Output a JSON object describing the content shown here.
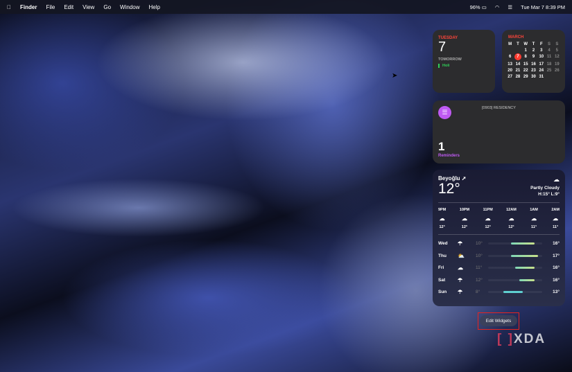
{
  "menubar": {
    "apple": "",
    "items": [
      "Finder",
      "File",
      "Edit",
      "View",
      "Go",
      "Window",
      "Help"
    ],
    "battery": "96%",
    "datetime": "Tue Mar 7  8:39 PM"
  },
  "calendar_day": {
    "weekday": "TUESDAY",
    "day": "7",
    "tomorrow": "TOMORROW",
    "event": "Holi"
  },
  "calendar_month": {
    "month": "MARCH",
    "headers": [
      "M",
      "T",
      "W",
      "T",
      "F",
      "S",
      "S"
    ],
    "days": [
      "",
      "",
      "1",
      "2",
      "3",
      "4",
      "5",
      "6",
      "7",
      "8",
      "9",
      "10",
      "11",
      "12",
      "13",
      "14",
      "15",
      "16",
      "17",
      "18",
      "19",
      "20",
      "21",
      "22",
      "23",
      "24",
      "25",
      "26",
      "27",
      "28",
      "29",
      "30",
      "31"
    ],
    "today": "7"
  },
  "reminders": {
    "list": "[0903] RESIDENCY",
    "count": "1",
    "label": "Reminders"
  },
  "weather": {
    "location": "Beyoğlu",
    "temp": "12°",
    "condition": "Partly Cloudy",
    "hilo": "H:15° L:9°",
    "hourly": [
      {
        "t": "9PM",
        "v": "12°"
      },
      {
        "t": "10PM",
        "v": "12°"
      },
      {
        "t": "11PM",
        "v": "12°"
      },
      {
        "t": "12AM",
        "v": "12°"
      },
      {
        "t": "1AM",
        "v": "11°"
      },
      {
        "t": "2AM",
        "v": "11°"
      }
    ],
    "daily": [
      {
        "d": "Wed",
        "icon": "rain-cloud",
        "lo": "10°",
        "hi": "16°",
        "low": 10,
        "high": 16
      },
      {
        "d": "Thu",
        "icon": "sun-cloud",
        "lo": "10°",
        "hi": "17°",
        "low": 10,
        "high": 17
      },
      {
        "d": "Fri",
        "icon": "cloud",
        "lo": "11°",
        "hi": "16°",
        "low": 11,
        "high": 16
      },
      {
        "d": "Sat",
        "icon": "rain-cloud",
        "lo": "12°",
        "hi": "16°",
        "low": 12,
        "high": 16
      },
      {
        "d": "Sun",
        "icon": "rain-cloud",
        "lo": "8°",
        "hi": "13°",
        "low": 8,
        "high": 13
      }
    ]
  },
  "edit_widgets": "Edit Widgets",
  "watermark": "XDA"
}
